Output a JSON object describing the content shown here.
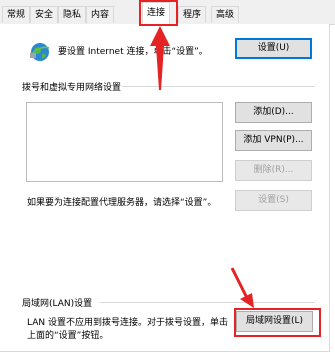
{
  "tabs": [
    {
      "label": "常规"
    },
    {
      "label": "安全"
    },
    {
      "label": "隐私"
    },
    {
      "label": "内容"
    },
    {
      "label": "连接"
    },
    {
      "label": "程序"
    },
    {
      "label": "高级"
    }
  ],
  "active_tab": "连接",
  "setup": {
    "text": "要设置 Internet 连接，单击“设置”。",
    "button": "设置(U)"
  },
  "dialup": {
    "title": "拨号和虚拟专用网络设置",
    "add_button": "添加(D)...",
    "add_vpn_button": "添加 VPN(P)...",
    "delete_button": "删除(R)...",
    "settings_button": "设置(S)",
    "proxy_note": "如果要为连接配置代理服务器，请选择“设置”。"
  },
  "lan": {
    "title": "局域网(LAN)设置",
    "note_line1": "LAN 设置不应用到拨号连接。对于拨号设置，单击",
    "note_line2": "上面的“设置”按钮。",
    "button": "局域网设置(L)"
  },
  "annotation_color": "#e52324"
}
